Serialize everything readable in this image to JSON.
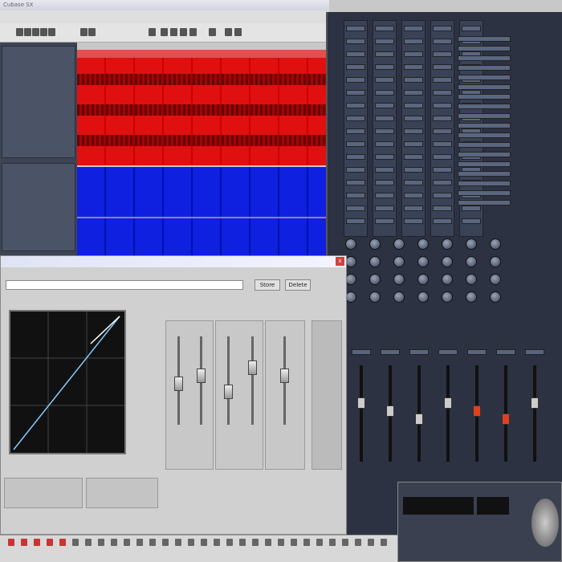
{
  "window": {
    "title": "Cubase SX"
  },
  "dialog": {
    "title": "",
    "close_label": "x",
    "preset_value": "",
    "store_label": "Store",
    "remove_label": "Delete"
  },
  "colors": {
    "left_channel": "#e01010",
    "right_channel": "#1020e0",
    "mixer_bg": "#2c3242",
    "dialog_bg": "#d0d0d0"
  },
  "icons": [
    "save-icon",
    "open-icon",
    "undo-icon",
    "pencil-icon",
    "eraser-icon",
    "zoom-icon",
    "mute-icon",
    "knob-icon",
    "fader-icon",
    "close-icon"
  ]
}
